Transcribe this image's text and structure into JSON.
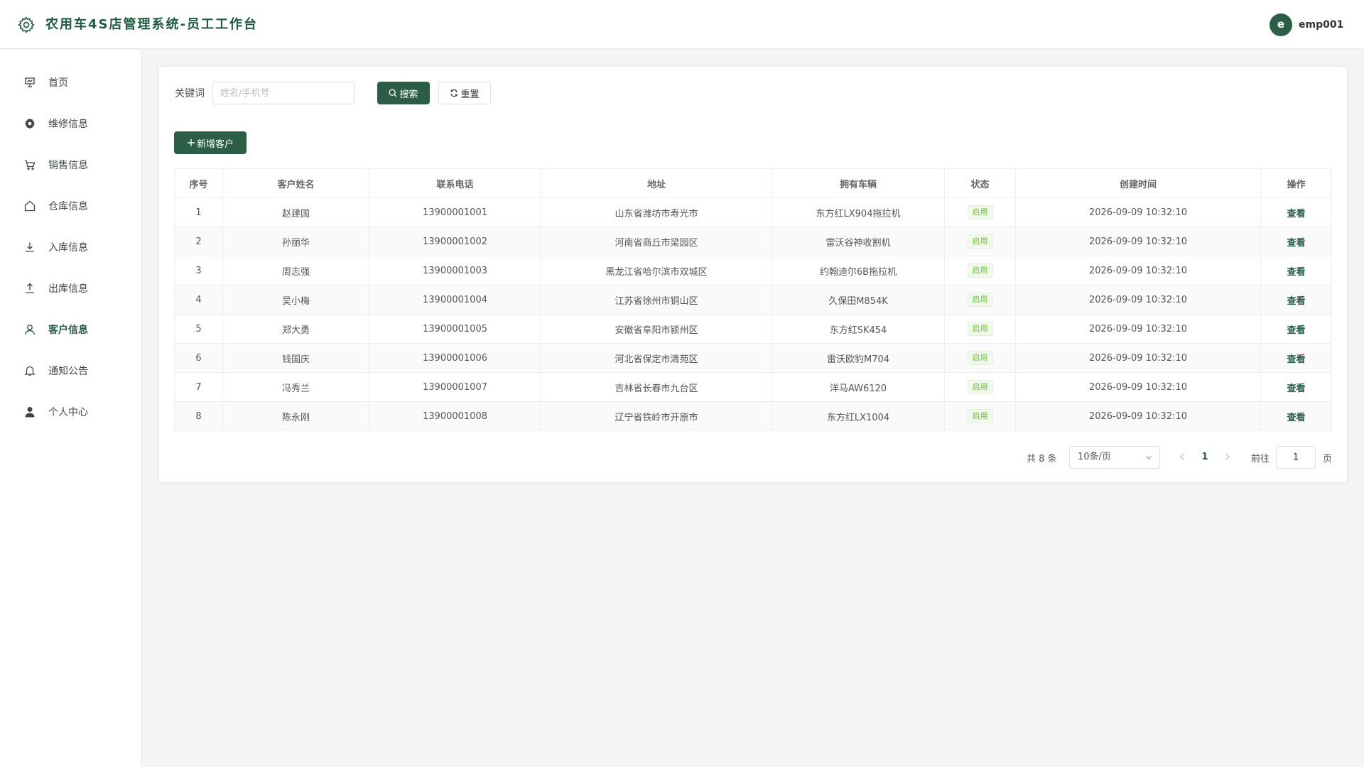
{
  "header": {
    "title": "农用车4S店管理系统-员工工作台",
    "avatar_letter": "e",
    "username": "emp001"
  },
  "sidebar": {
    "items": [
      {
        "label": "首页",
        "icon": "presentation-icon"
      },
      {
        "label": "维修信息",
        "icon": "gear-icon"
      },
      {
        "label": "销售信息",
        "icon": "cart-icon"
      },
      {
        "label": "仓库信息",
        "icon": "house-icon"
      },
      {
        "label": "入库信息",
        "icon": "download-icon"
      },
      {
        "label": "出库信息",
        "icon": "upload-icon"
      },
      {
        "label": "客户信息",
        "icon": "user-icon",
        "active": true
      },
      {
        "label": "通知公告",
        "icon": "bell-icon"
      },
      {
        "label": "个人中心",
        "icon": "user-filled-icon"
      }
    ]
  },
  "search": {
    "label": "关键词",
    "placeholder": "姓名/手机号",
    "value": "",
    "search_label": "搜索",
    "reset_label": "重置"
  },
  "toolbar": {
    "add_label": "新增客户"
  },
  "table": {
    "columns": [
      "序号",
      "客户姓名",
      "联系电话",
      "地址",
      "拥有车辆",
      "状态",
      "创建时间",
      "操作"
    ],
    "rows": [
      {
        "index": "1",
        "name": "赵建国",
        "phone": "13900001001",
        "address": "山东省潍坊市寿光市",
        "vehicle": "东方红LX904拖拉机",
        "status": "启用",
        "created": "2026-09-09 10:32:10",
        "action": "查看"
      },
      {
        "index": "2",
        "name": "孙丽华",
        "phone": "13900001002",
        "address": "河南省商丘市梁园区",
        "vehicle": "雷沃谷神收割机",
        "status": "启用",
        "created": "2026-09-09 10:32:10",
        "action": "查看"
      },
      {
        "index": "3",
        "name": "周志强",
        "phone": "13900001003",
        "address": "黑龙江省哈尔滨市双城区",
        "vehicle": "约翰迪尔6B拖拉机",
        "status": "启用",
        "created": "2026-09-09 10:32:10",
        "action": "查看"
      },
      {
        "index": "4",
        "name": "吴小梅",
        "phone": "13900001004",
        "address": "江苏省徐州市铜山区",
        "vehicle": "久保田M854K",
        "status": "启用",
        "created": "2026-09-09 10:32:10",
        "action": "查看"
      },
      {
        "index": "5",
        "name": "郑大勇",
        "phone": "13900001005",
        "address": "安徽省阜阳市颍州区",
        "vehicle": "东方红SK454",
        "status": "启用",
        "created": "2026-09-09 10:32:10",
        "action": "查看"
      },
      {
        "index": "6",
        "name": "钱国庆",
        "phone": "13900001006",
        "address": "河北省保定市清苑区",
        "vehicle": "雷沃欧豹M704",
        "status": "启用",
        "created": "2026-09-09 10:32:10",
        "action": "查看"
      },
      {
        "index": "7",
        "name": "冯秀兰",
        "phone": "13900001007",
        "address": "吉林省长春市九台区",
        "vehicle": "洋马AW6120",
        "status": "启用",
        "created": "2026-09-09 10:32:10",
        "action": "查看"
      },
      {
        "index": "8",
        "name": "陈永刚",
        "phone": "13900001008",
        "address": "辽宁省铁岭市开原市",
        "vehicle": "东方红LX1004",
        "status": "启用",
        "created": "2026-09-09 10:32:10",
        "action": "查看"
      }
    ]
  },
  "pagination": {
    "total_text": "共 8 条",
    "page_size": "10条/页",
    "current_page": "1",
    "goto_label": "前往",
    "goto_value": "1",
    "page_suffix": "页"
  },
  "colors": {
    "primary": "#2b5d47",
    "title": "#1f5a3f",
    "status_green": "#67c23a"
  }
}
